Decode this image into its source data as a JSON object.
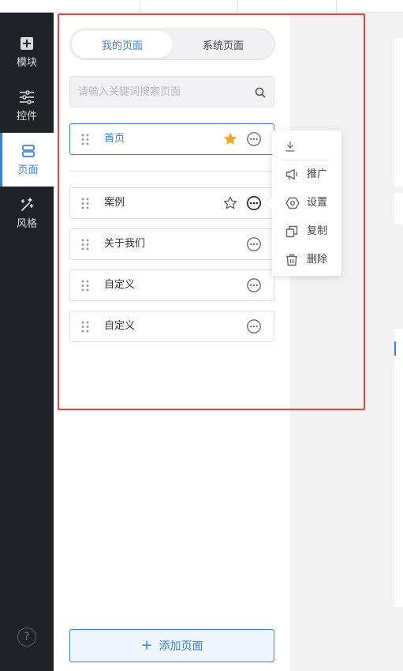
{
  "sidebar": {
    "items": [
      {
        "label": "模块",
        "icon": "plus-square-icon",
        "active": false
      },
      {
        "label": "控件",
        "icon": "sliders-icon",
        "active": false
      },
      {
        "label": "页面",
        "icon": "pages-icon",
        "active": true
      },
      {
        "label": "风格",
        "icon": "magic-wand-icon",
        "active": false
      }
    ],
    "help_icon": "?"
  },
  "panel": {
    "tabs": [
      {
        "label": "我的页面",
        "active": true
      },
      {
        "label": "系统页面",
        "active": false
      }
    ],
    "search": {
      "placeholder": "请输入关键词搜索页面",
      "value": ""
    },
    "pages": [
      {
        "name": "首页",
        "starred": true,
        "selected": true
      },
      {
        "name": "案例",
        "starred": false,
        "star_visible": true
      },
      {
        "name": "关于我们",
        "starred": false
      },
      {
        "name": "自定义",
        "starred": false
      },
      {
        "name": "自定义",
        "starred": false
      }
    ],
    "add_button": "添加页面"
  },
  "context_menu": {
    "items": [
      {
        "label": "推广",
        "icon": "megaphone-icon"
      },
      {
        "label": "设置",
        "icon": "settings-hex-icon"
      },
      {
        "label": "复制",
        "icon": "copy-icon"
      },
      {
        "label": "删除",
        "icon": "trash-icon"
      }
    ]
  },
  "colors": {
    "accent": "#3b82e0",
    "sidebar_bg": "#1f2227",
    "star": "#f5a623",
    "highlight_frame": "#e0483f"
  }
}
